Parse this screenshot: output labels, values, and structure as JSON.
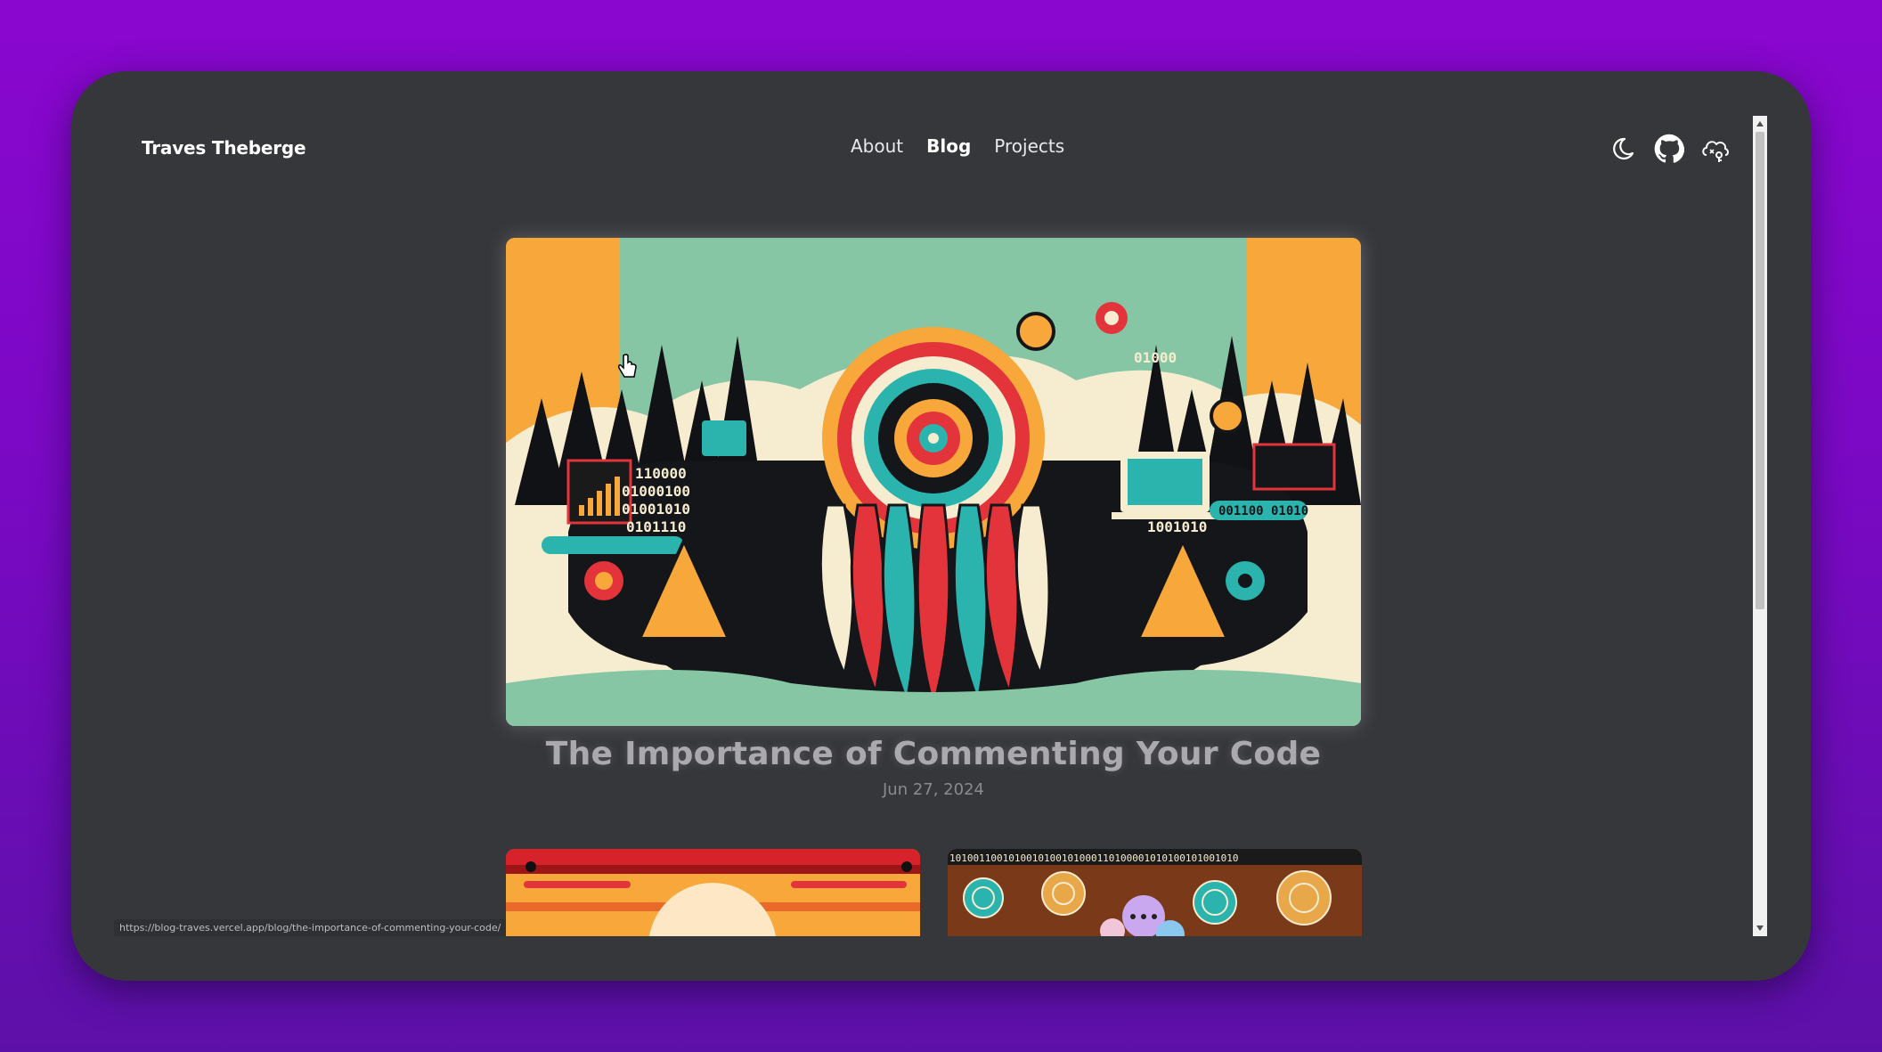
{
  "site": {
    "brand": "Traves Theberge",
    "nav": [
      {
        "label": "About",
        "active": false
      },
      {
        "label": "Blog",
        "active": true
      },
      {
        "label": "Projects",
        "active": false
      }
    ],
    "icons": [
      "moon-icon",
      "github-icon",
      "cloud-key-icon"
    ]
  },
  "featured": {
    "title": "The Importance of Commenting Your Code",
    "date": "Jun 27, 2024"
  },
  "cards": [
    {
      "name": "sunset-card"
    },
    {
      "name": "pattern-card"
    }
  ],
  "statusbar": {
    "url": "https://blog-traves.vercel.app/blog/the-importance-of-commenting-your-code/"
  },
  "colors": {
    "background": "#8a07cf",
    "window": "#36373a",
    "title": "#a9a9ae"
  }
}
